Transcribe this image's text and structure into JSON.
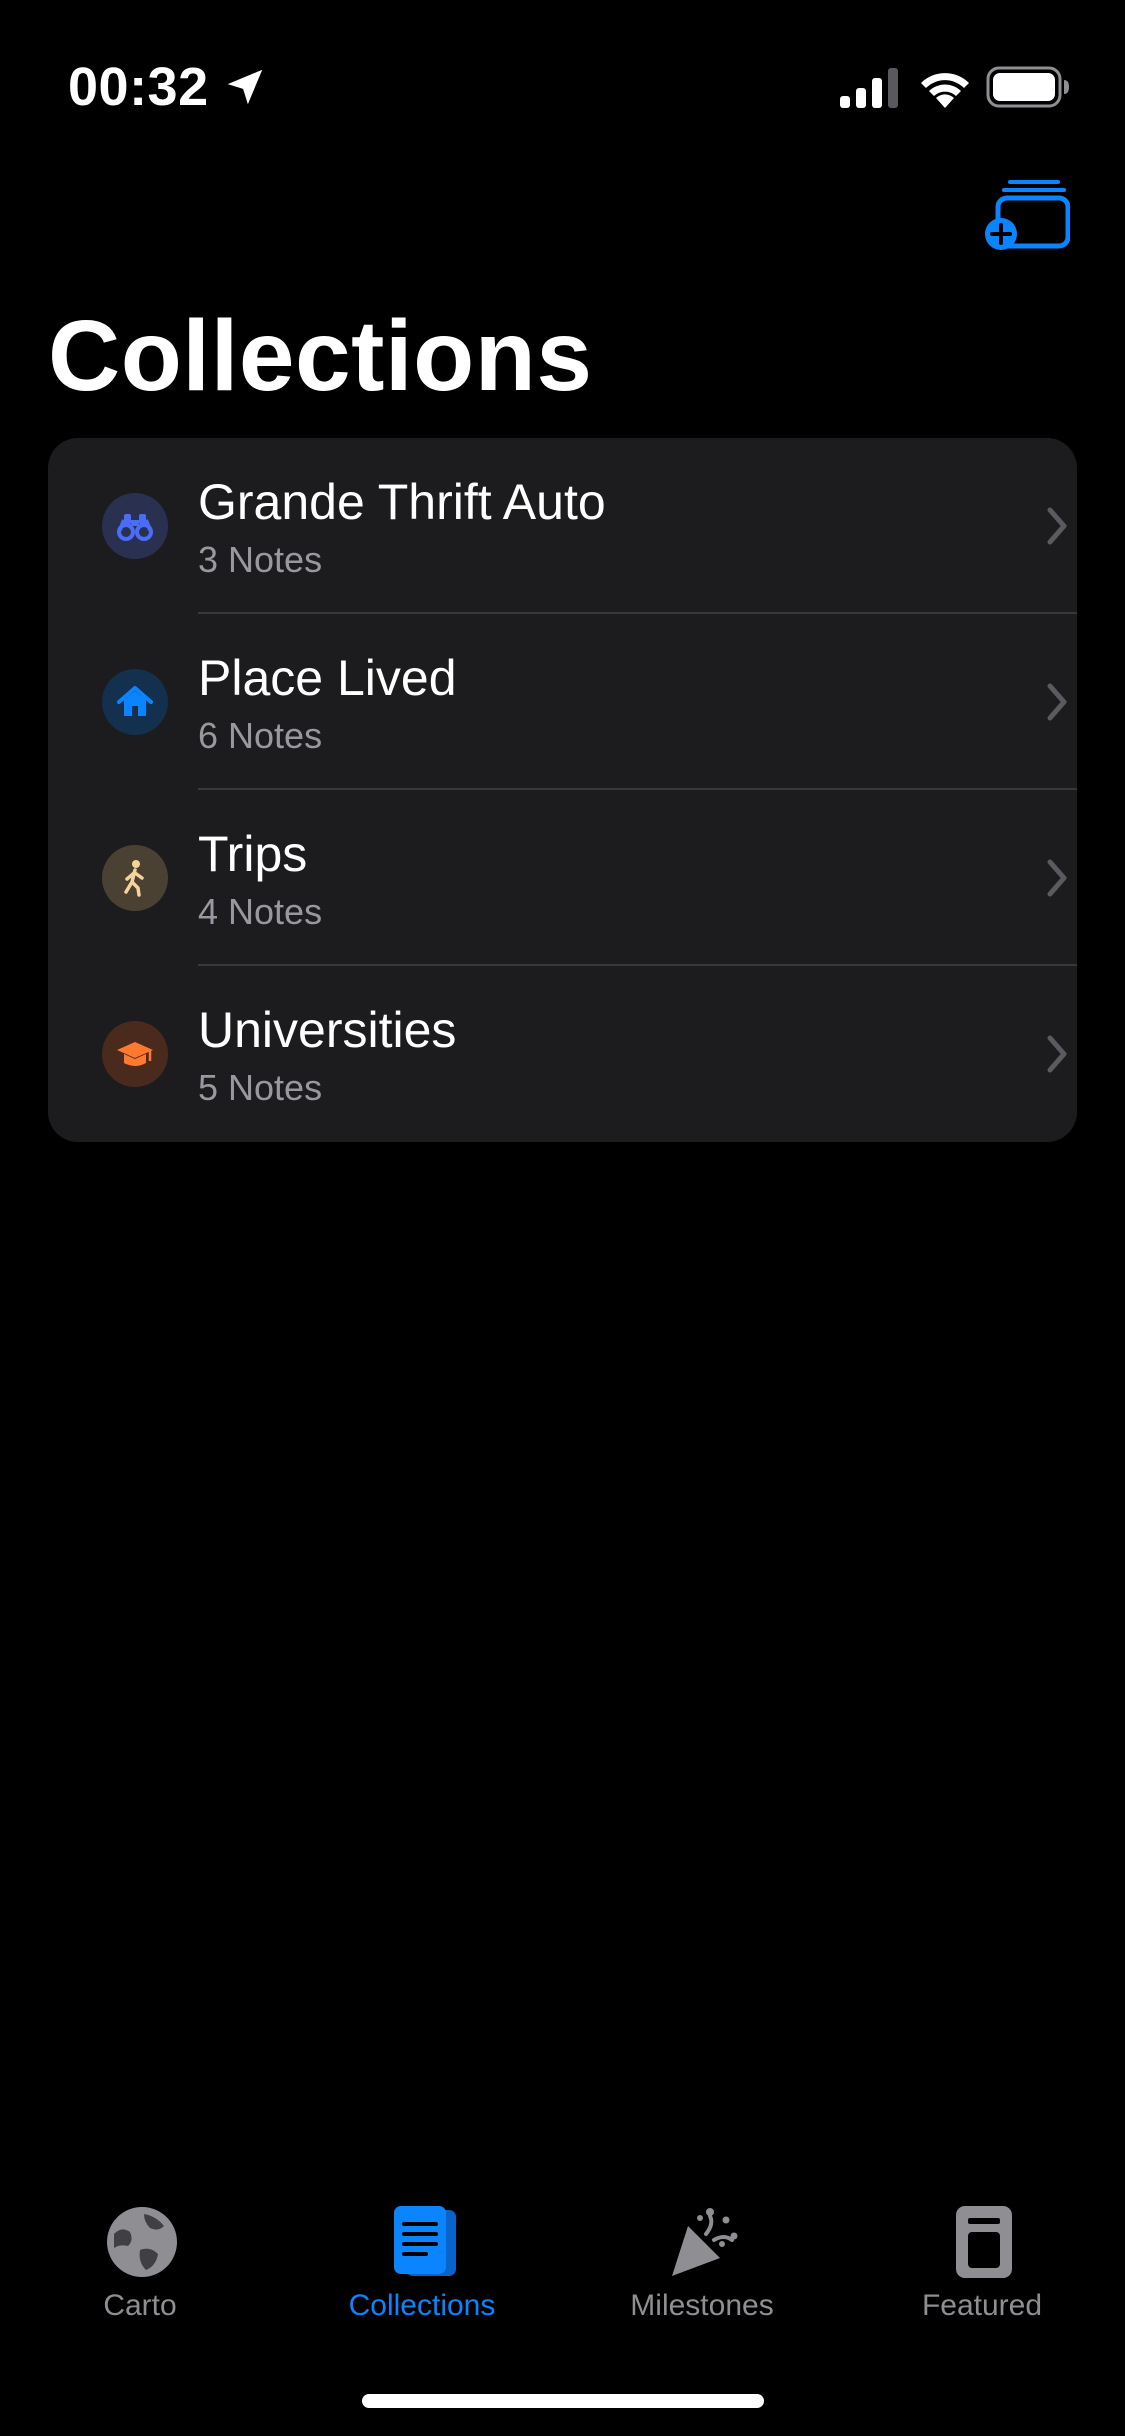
{
  "status": {
    "time": "00:32"
  },
  "header": {
    "title": "Collections",
    "add_icon": "add-collection-icon"
  },
  "collections": [
    {
      "title": "Grande Thrift Auto",
      "subtitle": "3 Notes",
      "icon": "binoculars-icon",
      "color": "#4a6cf7",
      "bg": "#2a3050"
    },
    {
      "title": "Place Lived",
      "subtitle": "6 Notes",
      "icon": "house-icon",
      "color": "#0a84ff",
      "bg": "#13304e"
    },
    {
      "title": "Trips",
      "subtitle": "4 Notes",
      "icon": "walking-icon",
      "color": "#f5d39a",
      "bg": "#4a4133"
    },
    {
      "title": "Universities",
      "subtitle": "5 Notes",
      "icon": "graduation-cap-icon",
      "color": "#ff7a30",
      "bg": "#4a2a1c"
    }
  ],
  "tabs": [
    {
      "label": "Carto",
      "icon": "globe-icon",
      "active": false
    },
    {
      "label": "Collections",
      "icon": "notes-icon",
      "active": true
    },
    {
      "label": "Milestones",
      "icon": "party-popper-icon",
      "active": false
    },
    {
      "label": "Featured",
      "icon": "featured-book-icon",
      "active": false
    }
  ],
  "colors": {
    "accent": "#0a84ff",
    "background": "#000000",
    "card": "#1c1c1e",
    "secondary_text": "#98989f",
    "inactive_tab": "#8e8e93"
  }
}
